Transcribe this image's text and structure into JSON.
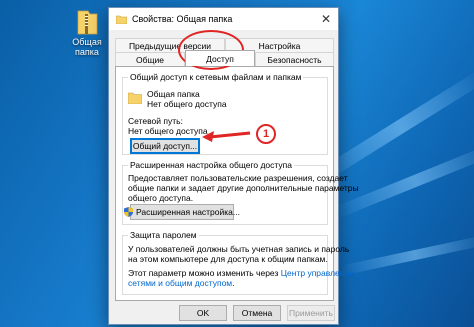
{
  "desktop": {
    "icon_label_line1": "Общая",
    "icon_label_line2": "папка",
    "icon": "folder-zip-icon"
  },
  "dialog": {
    "title": "Свойства: Общая папка",
    "close_glyph": "✕",
    "tabs_row1": [
      "Предыдущие версии",
      "Настройка"
    ],
    "tabs_row2": [
      "Общие",
      "Доступ",
      "Безопасность"
    ],
    "selected_tab": "Доступ",
    "network_share": {
      "group_title": "Общий доступ к сетевым файлам и папкам",
      "folder_name": "Общая папка",
      "folder_status": "Нет общего доступа",
      "network_path_label": "Сетевой путь:",
      "network_path_value": "Нет общего доступа",
      "share_button": "Общий доступ..."
    },
    "advanced": {
      "group_title": "Расширенная настройка общего доступа",
      "desc_line1": "Предоставляет пользовательские разрешения, создает",
      "desc_line2": "общие папки и задает другие дополнительные параметры",
      "desc_line3": "общего доступа.",
      "button": "Расширенная настройка..."
    },
    "password": {
      "group_title": "Защита паролем",
      "line1": "У пользователей должны быть учетная запись и пароль",
      "line2": "на этом компьютере для доступа к общим папкам.",
      "line3_prefix": "Этот параметр можно изменить через",
      "link1": "Центр управления",
      "link2": "сетями и общим доступом",
      "suffix": "."
    },
    "buttons": {
      "ok": "OK",
      "cancel": "Отмена",
      "apply": "Применить"
    }
  },
  "annotation": {
    "number": "1",
    "color": "#e02525"
  }
}
